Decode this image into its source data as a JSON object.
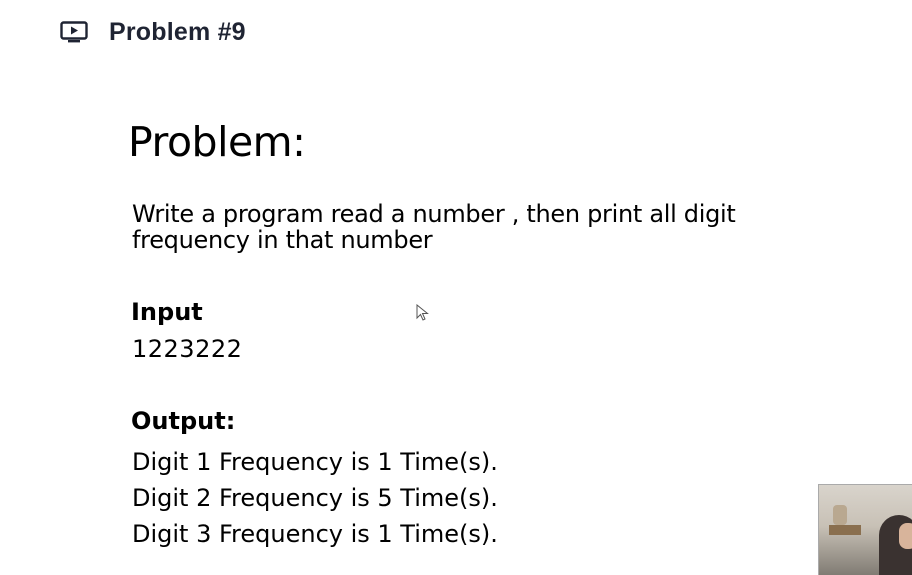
{
  "header": {
    "title": "Problem #9",
    "icon": "video-play-icon"
  },
  "slide": {
    "heading": "Problem:",
    "statement_lines": [
      "Write a program read a number , then print all digit",
      "frequency in that number"
    ],
    "input_label": "Input",
    "input_value": "1223222",
    "output_label": "Output:",
    "output_lines": [
      "Digit 1 Frequency is 1 Time(s).",
      "Digit 2 Frequency is 5 Time(s).",
      "Digit 3 Frequency is 1 Time(s)."
    ]
  },
  "colors": {
    "header_text": "#1f2433",
    "slide_text": "#000000",
    "background": "#ffffff"
  }
}
